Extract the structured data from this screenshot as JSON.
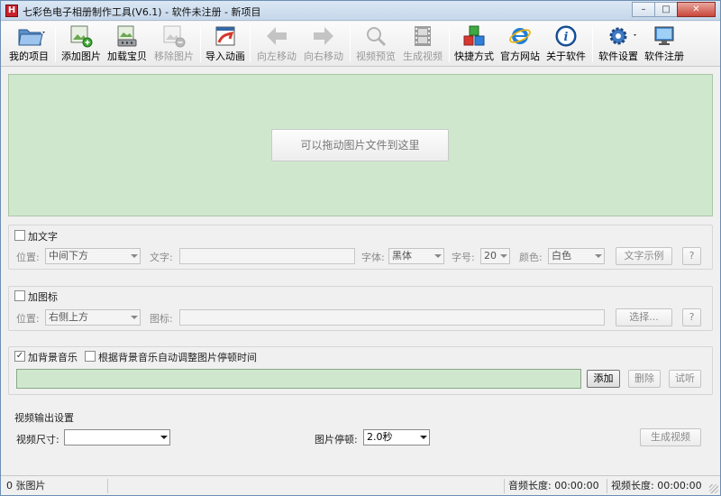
{
  "window": {
    "title": "七彩色电子相册制作工具(V6.1) - 软件未注册 - 新项目",
    "icon_letter": "H",
    "min": "–",
    "max": "□",
    "close": "✕"
  },
  "toolbar": {
    "my_project": "我的项目",
    "add_image": "添加图片",
    "load_treasure": "加载宝贝",
    "remove_image": "移除图片",
    "import_animation": "导入动画",
    "move_left": "向左移动",
    "move_right": "向右移动",
    "video_preview": "视频预览",
    "generate_video": "生成视频",
    "shortcut": "快捷方式",
    "official_site": "官方网站",
    "about": "关于软件",
    "settings": "软件设置",
    "register": "软件注册"
  },
  "drop_area": {
    "hint": "可以拖动图片文件到这里"
  },
  "text_section": {
    "checkbox_label": "加文字",
    "position_label": "位置:",
    "position_value": "中间下方",
    "text_label": "文字:",
    "font_label": "字体:",
    "font_value": "黑体",
    "size_label": "字号:",
    "size_value": "20",
    "color_label": "颜色:",
    "color_value": "白色",
    "sample_button": "文字示例",
    "help_button": "?"
  },
  "icon_section": {
    "checkbox_label": "加图标",
    "position_label": "位置:",
    "position_value": "右侧上方",
    "icon_label": "图标:",
    "select_button": "选择...",
    "help_button": "?"
  },
  "music_section": {
    "bg_music_label": "加背景音乐",
    "bg_music_checked": true,
    "auto_adjust_label": "根据背景音乐自动调整图片停顿时间",
    "auto_adjust_checked": false,
    "add_button": "添加",
    "delete_button": "删除",
    "listen_button": "试听"
  },
  "output_section": {
    "title": "视频输出设置",
    "size_label": "视频尺寸:",
    "size_value": "",
    "pause_label": "图片停顿:",
    "pause_value": "2.0秒",
    "generate_button": "生成视频"
  },
  "statusbar": {
    "images": "0 张图片",
    "audio_length": "音频长度: 00:00:00",
    "video_length": "视频长度: 00:00:00"
  }
}
